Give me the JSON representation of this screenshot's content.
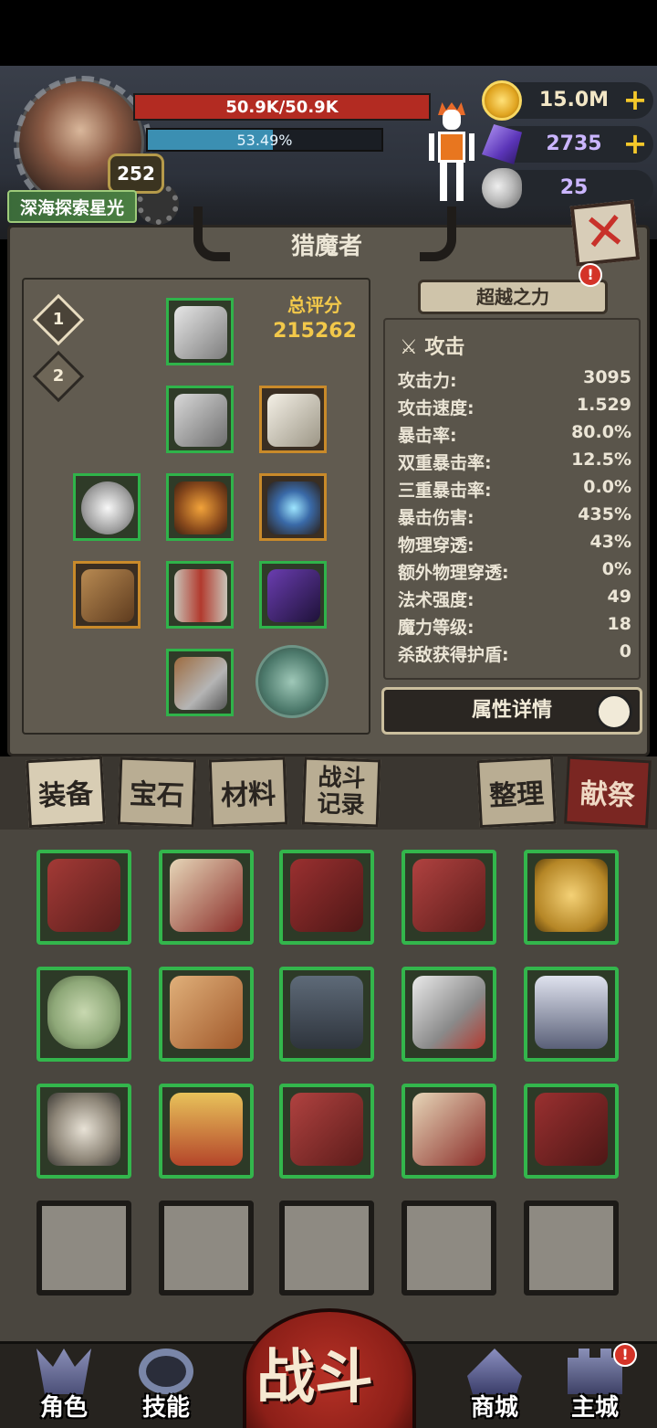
{
  "player": {
    "name": "深海探索星光",
    "level": "252",
    "hp_text": "50.9K/50.9K",
    "exp_text": "53.49%",
    "exp_fraction": 0.5349
  },
  "resources": [
    {
      "icon": "gold-coin-icon",
      "value": "15.0M",
      "plus": "+"
    },
    {
      "icon": "purple-crystal-icon",
      "value": "2735",
      "plus": "+"
    },
    {
      "icon": "ram-skull-icon",
      "value": "25",
      "plus": ""
    }
  ],
  "panel": {
    "title": "猎魔者",
    "close_icon": "close-x-icon",
    "presets": [
      "1",
      "2"
    ],
    "score_label": "总评分",
    "score_value": "215262",
    "transcend_label": "超越之力",
    "transcend_badge": "!"
  },
  "stats": {
    "section_title": "攻击",
    "rows": [
      {
        "k": "攻击力:",
        "v": "3095"
      },
      {
        "k": "攻击速度:",
        "v": "1.529"
      },
      {
        "k": "暴击率:",
        "v": "80.0%"
      },
      {
        "k": "双重暴击率:",
        "v": "12.5%"
      },
      {
        "k": "三重暴击率:",
        "v": "0.0%"
      },
      {
        "k": "暴击伤害:",
        "v": "435%"
      },
      {
        "k": "物理穿透:",
        "v": "43%"
      },
      {
        "k": "额外物理穿透:",
        "v": "0%"
      },
      {
        "k": "法术强度:",
        "v": "49"
      },
      {
        "k": "魔力等级:",
        "v": "18"
      },
      {
        "k": "杀敌获得护盾:",
        "v": "0"
      }
    ],
    "detail_button": "属性详情"
  },
  "tabs": [
    {
      "label": "装备",
      "active": true
    },
    {
      "label": "宝石",
      "active": false
    },
    {
      "label": "材料",
      "active": false
    },
    {
      "label": "战斗记录",
      "active": false
    },
    {
      "label": "整理",
      "active": false
    },
    {
      "label": "献祭",
      "active": false
    }
  ],
  "bottom_nav": [
    {
      "label": "角色",
      "icon": "character-helmet-icon"
    },
    {
      "label": "技能",
      "icon": "skill-swirl-icon"
    },
    {
      "label": "战斗",
      "icon": ""
    },
    {
      "label": "商城",
      "icon": "shop-tent-icon"
    },
    {
      "label": "主城",
      "icon": "castle-icon",
      "badge": "!"
    }
  ],
  "colors": {
    "hp": "#b32b22",
    "exp": "#3b8fb2",
    "score": "#f2c84a",
    "rarity_green": "#33b64c",
    "rarity_orange": "#c98a2a"
  }
}
